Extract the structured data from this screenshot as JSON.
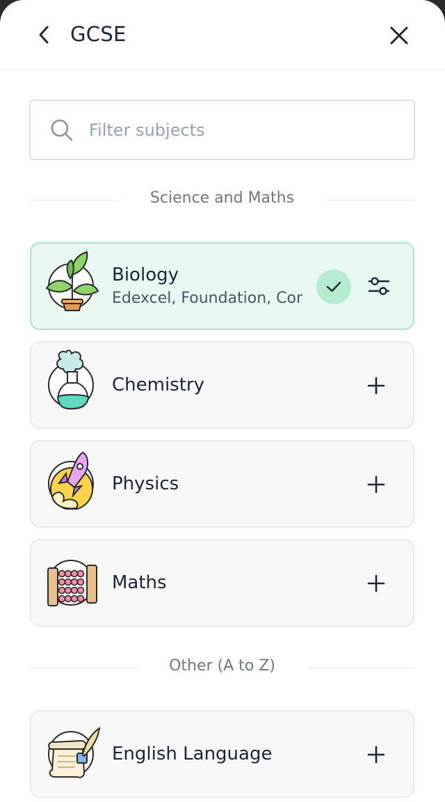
{
  "header": {
    "title": "GCSE",
    "back_icon": "chevron-left-icon",
    "close_icon": "close-icon"
  },
  "search": {
    "placeholder": "Filter subjects",
    "value": "",
    "icon": "search-icon"
  },
  "sections": [
    {
      "label": "Science and Maths",
      "subjects": [
        {
          "name": "Biology",
          "detail": "Edexcel, Foundation, Combined Science",
          "selected": true,
          "icon": "plant-icon",
          "action_icon": "settings-sliders-icon"
        },
        {
          "name": "Chemistry",
          "detail": "",
          "selected": false,
          "icon": "flask-icon",
          "action_icon": "plus-icon"
        },
        {
          "name": "Physics",
          "detail": "",
          "selected": false,
          "icon": "rocket-icon",
          "action_icon": "plus-icon"
        },
        {
          "name": "Maths",
          "detail": "",
          "selected": false,
          "icon": "abacus-icon",
          "action_icon": "plus-icon"
        }
      ]
    },
    {
      "label": "Other (A to Z)",
      "subjects": [
        {
          "name": "English Language",
          "detail": "",
          "selected": false,
          "icon": "scroll-quill-icon",
          "action_icon": "plus-icon"
        }
      ]
    }
  ],
  "colors": {
    "selected_bg": "#e9f9f1",
    "selected_border": "#a8e6c7",
    "check_badge": "#b5ebcf",
    "text_primary": "#1b2536",
    "text_muted": "#6e7782"
  }
}
